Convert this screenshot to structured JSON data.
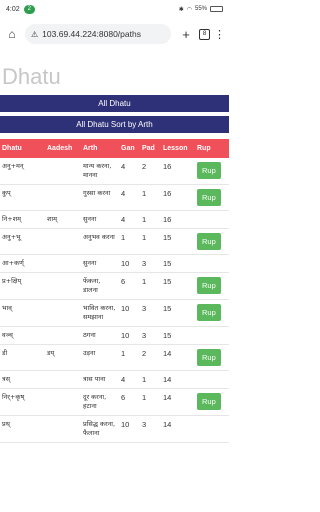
{
  "status": {
    "time": "4:02",
    "badge": "2",
    "battery": "55%"
  },
  "browser": {
    "url": "103.69.44.224:8080/paths",
    "tab_count": "8"
  },
  "page": {
    "title": "Dhatu"
  },
  "nav": {
    "all": "All Dhatu",
    "sort": "All Dhatu Sort by Arth"
  },
  "table": {
    "headers": [
      "Dhatu",
      "Aadesh",
      "Arth",
      "Gan",
      "Pad",
      "Lesson",
      "Rup"
    ],
    "rows": [
      {
        "dhatu": "अनु+मन्",
        "aadesh": "",
        "arth": "मान्य करना, मानना",
        "gan": "4",
        "pad": "2",
        "lesson": "16",
        "rup": "Rup"
      },
      {
        "dhatu": "कुप्",
        "aadesh": "",
        "arth": "गुस्सा करना",
        "gan": "4",
        "pad": "1",
        "lesson": "16",
        "rup": "Rup"
      },
      {
        "dhatu": "नि+शम्",
        "aadesh": "शाम्",
        "arth": "सुनना",
        "gan": "4",
        "pad": "1",
        "lesson": "16",
        "rup": ""
      },
      {
        "dhatu": "अनु+भू",
        "aadesh": "",
        "arth": "अनुभव करना",
        "gan": "1",
        "pad": "1",
        "lesson": "15",
        "rup": "Rup"
      },
      {
        "dhatu": "आ+कर्ण्",
        "aadesh": "",
        "arth": "सुनना",
        "gan": "10",
        "pad": "3",
        "lesson": "15",
        "rup": ""
      },
      {
        "dhatu": "प्र+क्षिप्",
        "aadesh": "",
        "arth": "फेंकना, डालना",
        "gan": "6",
        "pad": "1",
        "lesson": "15",
        "rup": "Rup"
      },
      {
        "dhatu": "भाव्",
        "aadesh": "",
        "arth": "भावित करना, समझाना",
        "gan": "10",
        "pad": "3",
        "lesson": "15",
        "rup": "Rup"
      },
      {
        "dhatu": "वञ्च्",
        "aadesh": "",
        "arth": "ठगना",
        "gan": "10",
        "pad": "3",
        "lesson": "15",
        "rup": ""
      },
      {
        "dhatu": "डी",
        "aadesh": "डय्",
        "arth": "उड़ना",
        "gan": "1",
        "pad": "2",
        "lesson": "14",
        "rup": "Rup"
      },
      {
        "dhatu": "त्रस्",
        "aadesh": "",
        "arth": "त्रास पाना",
        "gan": "4",
        "pad": "1",
        "lesson": "14",
        "rup": ""
      },
      {
        "dhatu": "निर्+कृष्",
        "aadesh": "",
        "arth": "दूर करना, हटाना",
        "gan": "6",
        "pad": "1",
        "lesson": "14",
        "rup": "Rup"
      },
      {
        "dhatu": "प्रथ्",
        "aadesh": "",
        "arth": "प्रसिद्ध करना, फैलाना",
        "gan": "10",
        "pad": "3",
        "lesson": "14",
        "rup": ""
      }
    ]
  }
}
